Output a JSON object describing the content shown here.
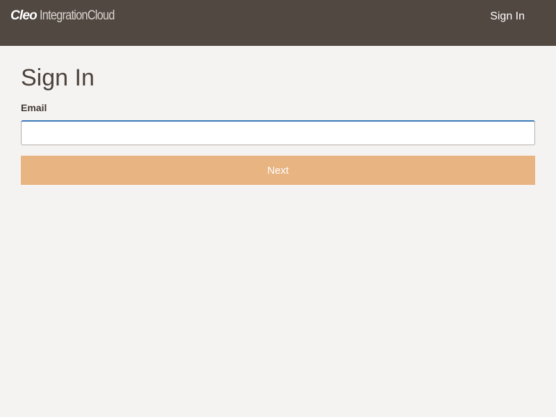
{
  "header": {
    "logo_brand": "Cleo",
    "logo_product": "IntegrationCloud",
    "nav_signin_label": "Sign In",
    "background_color": "#524842"
  },
  "form": {
    "title": "Sign In",
    "email_label": "Email",
    "email_value": "",
    "email_placeholder": "",
    "next_label": "Next",
    "next_button_color": "#e8b482"
  }
}
